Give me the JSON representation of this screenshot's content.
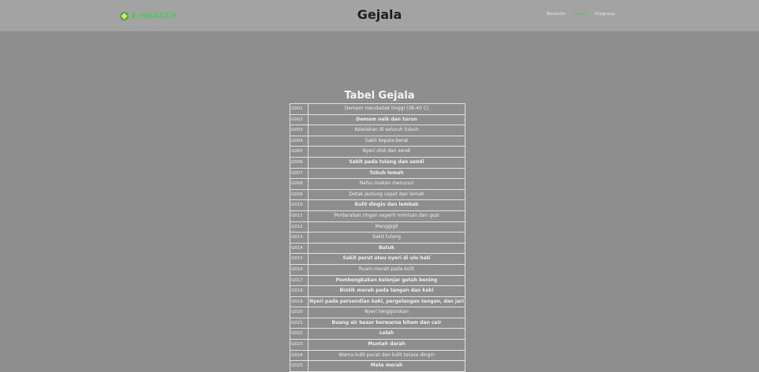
{
  "navbar": {
    "brand_text": "E-HEALTH",
    "page_heading": "Gejala",
    "links": [
      "Beranda",
      "Gejala",
      "Diagnosa"
    ]
  },
  "colors": {
    "background": "#8e8e8e",
    "navbar": "#a3a3a3",
    "brand_green": "#54c45e"
  },
  "table": {
    "title": "Tabel Gejala",
    "rows": [
      {
        "code": "G001",
        "name": "Demam mendadak tinggi (38-40 C)"
      },
      {
        "code": "G002",
        "name": "Demam naik dan turun"
      },
      {
        "code": "G003",
        "name": "Kelelahan di seluruh tubuh"
      },
      {
        "code": "G004",
        "name": "Sakit kepala berat"
      },
      {
        "code": "G005",
        "name": "Nyeri otot dan sendi"
      },
      {
        "code": "G006",
        "name": "Sakit pada tulang dan sendi"
      },
      {
        "code": "G007",
        "name": "Tubuh lemah"
      },
      {
        "code": "G008",
        "name": "Nafsu makan menurun"
      },
      {
        "code": "G009",
        "name": "Detak jantung cepat dan lemah"
      },
      {
        "code": "G010",
        "name": "Kulit dingin dan lembab"
      },
      {
        "code": "G011",
        "name": "Perdarahan ringan seperti mimisan dan gusi"
      },
      {
        "code": "G012",
        "name": "Menggigil"
      },
      {
        "code": "G013",
        "name": "Sakit tulang"
      },
      {
        "code": "G014",
        "name": "Batuk"
      },
      {
        "code": "G015",
        "name": "Sakit perut atau nyeri di ulu hati"
      },
      {
        "code": "G016",
        "name": "Ruam merah pada kulit"
      },
      {
        "code": "G017",
        "name": "Pembengkakan kelenjar getah bening"
      },
      {
        "code": "G018",
        "name": "Bintik merah pada tangan dan kaki"
      },
      {
        "code": "G019",
        "name": "Nyeri pada persendian kaki, pergelangan tangan, dan jari"
      },
      {
        "code": "G020",
        "name": "Nyeri tenggorokan"
      },
      {
        "code": "G021",
        "name": "Buang air besar berwarna hitam dan cair"
      },
      {
        "code": "G022",
        "name": "Lelah"
      },
      {
        "code": "G023",
        "name": "Muntah darah"
      },
      {
        "code": "G024",
        "name": "Warna kulit pucat dan kulit terasa dingin"
      },
      {
        "code": "G025",
        "name": "Mata merah"
      }
    ]
  }
}
